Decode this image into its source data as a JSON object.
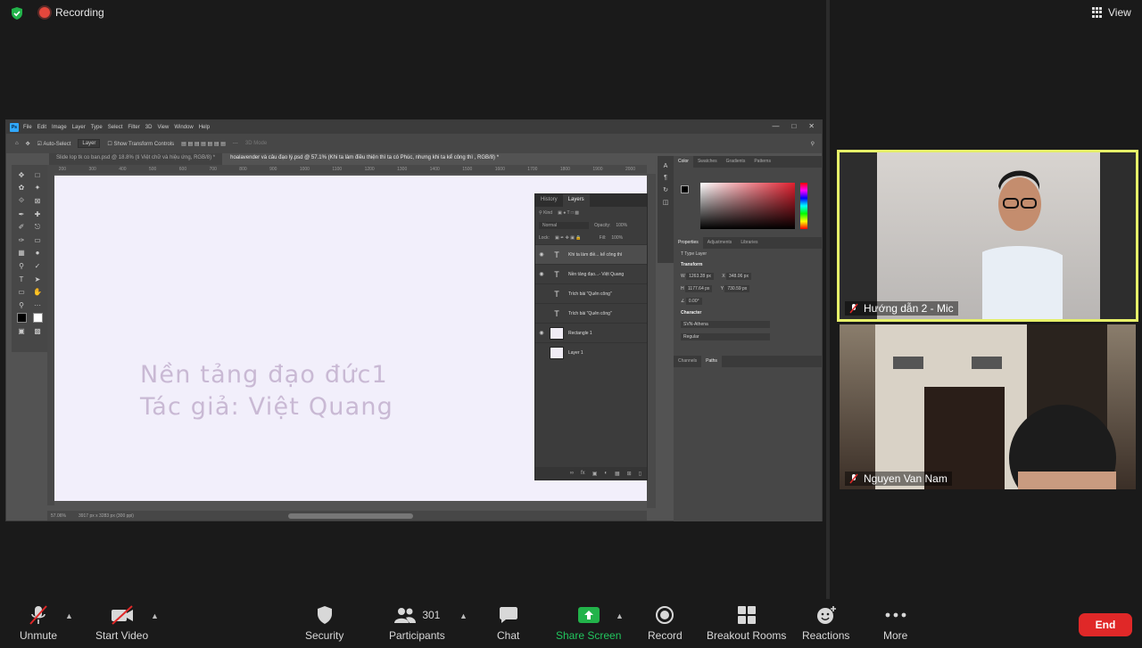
{
  "zoom": {
    "recording_label": "Recording",
    "view_label": "View"
  },
  "photoshop": {
    "menu": [
      "File",
      "Edit",
      "Image",
      "Layer",
      "Type",
      "Select",
      "Filter",
      "3D",
      "View",
      "Window",
      "Help"
    ],
    "options": {
      "auto_select": "Auto-Select",
      "layer_select": "Layer",
      "show_transform": "Show Transform Controls",
      "mode_3d": "3D Mode"
    },
    "tabs": [
      "Slide lop tk co ban.psd @ 18.8% (ti Việt chữ và hiệu ứng, RGB/8) *",
      "hoalavender và câu đạo lý.psd @ 57.1% (Khi ta làm điều thiện thì ta có Phúc, nhưng khi ta kể công thì , RGB/8) *"
    ],
    "ruler_marks": [
      "200",
      "300",
      "400",
      "500",
      "600",
      "700",
      "800",
      "900",
      "1000",
      "1100",
      "1200",
      "1300",
      "1400",
      "1500",
      "1600",
      "1700",
      "1800",
      "1900",
      "2000"
    ],
    "canvas_lines": [
      "Nền tảng đạo đức1",
      "Tác giả: Việt Quang"
    ],
    "status": {
      "zoom": "57.06%",
      "doc_size": "3917 px x 3283 px (300 ppi)"
    },
    "layers_panel": {
      "tab_history": "History",
      "tab_layers": "Layers",
      "kind": "Kind",
      "blend_mode": "Normal",
      "opacity_label": "Opacity:",
      "opacity_value": "100%",
      "lock_label": "Lock:",
      "fill_label": "Fill:",
      "fill_value": "100%",
      "layers": [
        {
          "name": "Khi ta làm điề... kể công thì",
          "type": "text",
          "visible": true,
          "selected": true
        },
        {
          "name": "Nền tảng đạo...- Việt Quang",
          "type": "text",
          "visible": true,
          "selected": false
        },
        {
          "name": "Trích bài \"Quên công\"",
          "type": "text",
          "visible": false,
          "selected": false
        },
        {
          "name": "Trích bài \"Quên công\"",
          "type": "text",
          "visible": false,
          "selected": false
        },
        {
          "name": "Rectangle 1",
          "type": "image",
          "visible": true,
          "selected": false
        },
        {
          "name": "Layer 1",
          "type": "image",
          "visible": false,
          "selected": false
        }
      ]
    },
    "right_panels": {
      "color_tabs": [
        "Color",
        "Swatches",
        "Gradients",
        "Patterns"
      ],
      "props_tabs": [
        "Properties",
        "Adjustments",
        "Libraries"
      ],
      "type_layer": "Type Layer",
      "transform": "Transform",
      "w": "W",
      "w_value": "1263.28 px",
      "x": "X",
      "x_value": "348.06 px",
      "h": "H",
      "h_value": "1177.64 px",
      "y": "Y",
      "y_value": "730.59 px",
      "angle": "0.00°",
      "character": "Character",
      "font_family": "SVN-Athena",
      "font_style": "Regular",
      "channels_tabs": [
        "Channels",
        "Paths"
      ]
    }
  },
  "participants": {
    "tile1_name": "Hướng dẫn 2 - Mic",
    "tile2_name": "Nguyen Van Nam"
  },
  "toolbar": {
    "unmute": "Unmute",
    "start_video": "Start Video",
    "security": "Security",
    "participants": "Participants",
    "participants_count": "301",
    "chat": "Chat",
    "share_screen": "Share Screen",
    "record": "Record",
    "breakout_rooms": "Breakout Rooms",
    "reactions": "Reactions",
    "more": "More",
    "end": "End"
  },
  "colors": {
    "share_green": "#22b34a",
    "end_red": "#e02828",
    "active_speaker": "#e6f069"
  }
}
